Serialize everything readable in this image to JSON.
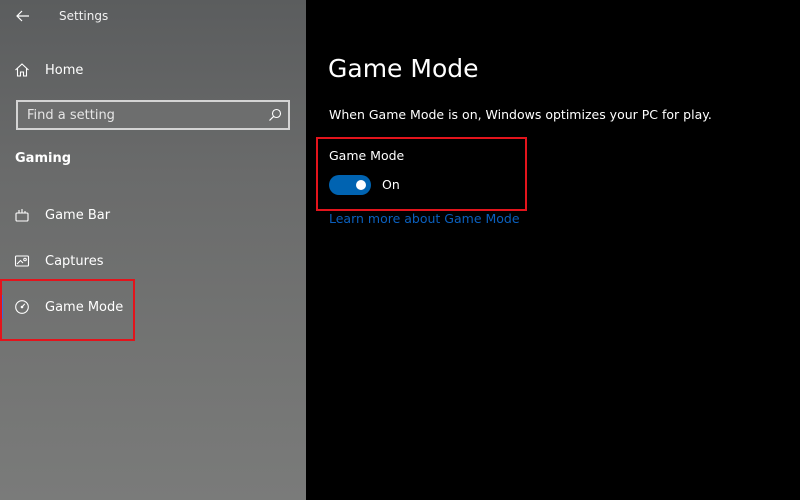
{
  "app": {
    "title": "Settings"
  },
  "sidebar": {
    "home_label": "Home",
    "search": {
      "placeholder": "Find a setting",
      "value": ""
    },
    "section_heading": "Gaming",
    "items": [
      {
        "label": "Game Bar",
        "icon": "game-bar-icon"
      },
      {
        "label": "Captures",
        "icon": "captures-icon"
      },
      {
        "label": "Game Mode",
        "icon": "game-mode-icon",
        "selected": true
      }
    ]
  },
  "main": {
    "title": "Game Mode",
    "description": "When Game Mode is on, Windows optimizes your PC for play.",
    "setting_label": "Game Mode",
    "toggle": {
      "on": true,
      "state_label": "On"
    },
    "link_label": "Learn more about Game Mode"
  },
  "colors": {
    "accent": "#0063b1",
    "link": "#0a5fbd",
    "highlight": "#e3141c",
    "active_indicator": "#3a6fd8"
  }
}
